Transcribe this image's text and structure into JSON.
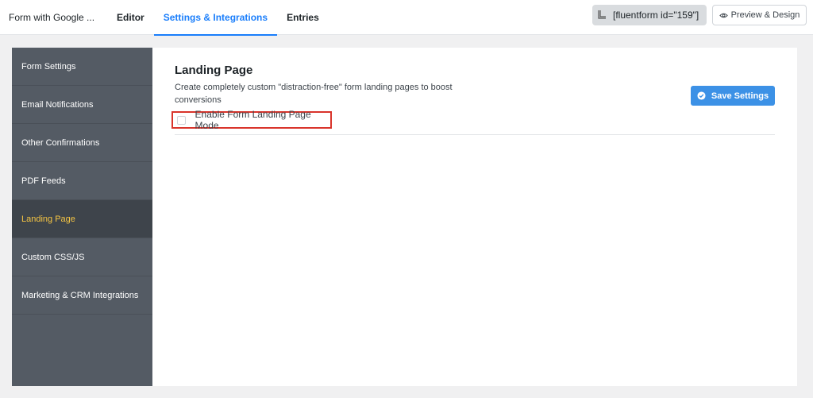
{
  "topbar": {
    "form_name": "Form with Google ...",
    "tabs": [
      {
        "label": "Editor",
        "active": false
      },
      {
        "label": "Settings & Integrations",
        "active": true
      },
      {
        "label": "Entries",
        "active": false
      }
    ],
    "shortcode": "[fluentform id=\"159\"]",
    "shortcode_icon": "copy-icon",
    "preview_label": "Preview & Design",
    "preview_icon": "eye-icon"
  },
  "sidebar": {
    "items": [
      {
        "label": "Form Settings",
        "active": false
      },
      {
        "label": "Email Notifications",
        "active": false
      },
      {
        "label": "Other Confirmations",
        "active": false
      },
      {
        "label": "PDF Feeds",
        "active": false
      },
      {
        "label": "Landing Page",
        "active": true
      },
      {
        "label": "Custom CSS/JS",
        "active": false
      },
      {
        "label": "Marketing & CRM Integrations",
        "active": false
      }
    ]
  },
  "main": {
    "title": "Landing Page",
    "description": "Create completely custom \"distraction-free\" form landing pages to boost conversions",
    "save_label": "Save Settings",
    "save_icon": "check-circle-icon",
    "landing_mode_label": "Enable Form Landing Page Mode",
    "landing_mode_checked": false
  },
  "colors": {
    "accent": "#1a7efb",
    "sidebar_bg": "#545b64",
    "sidebar_active_text": "#f5c543",
    "highlight_border": "#d9342b",
    "save_button": "#3c91e6"
  }
}
